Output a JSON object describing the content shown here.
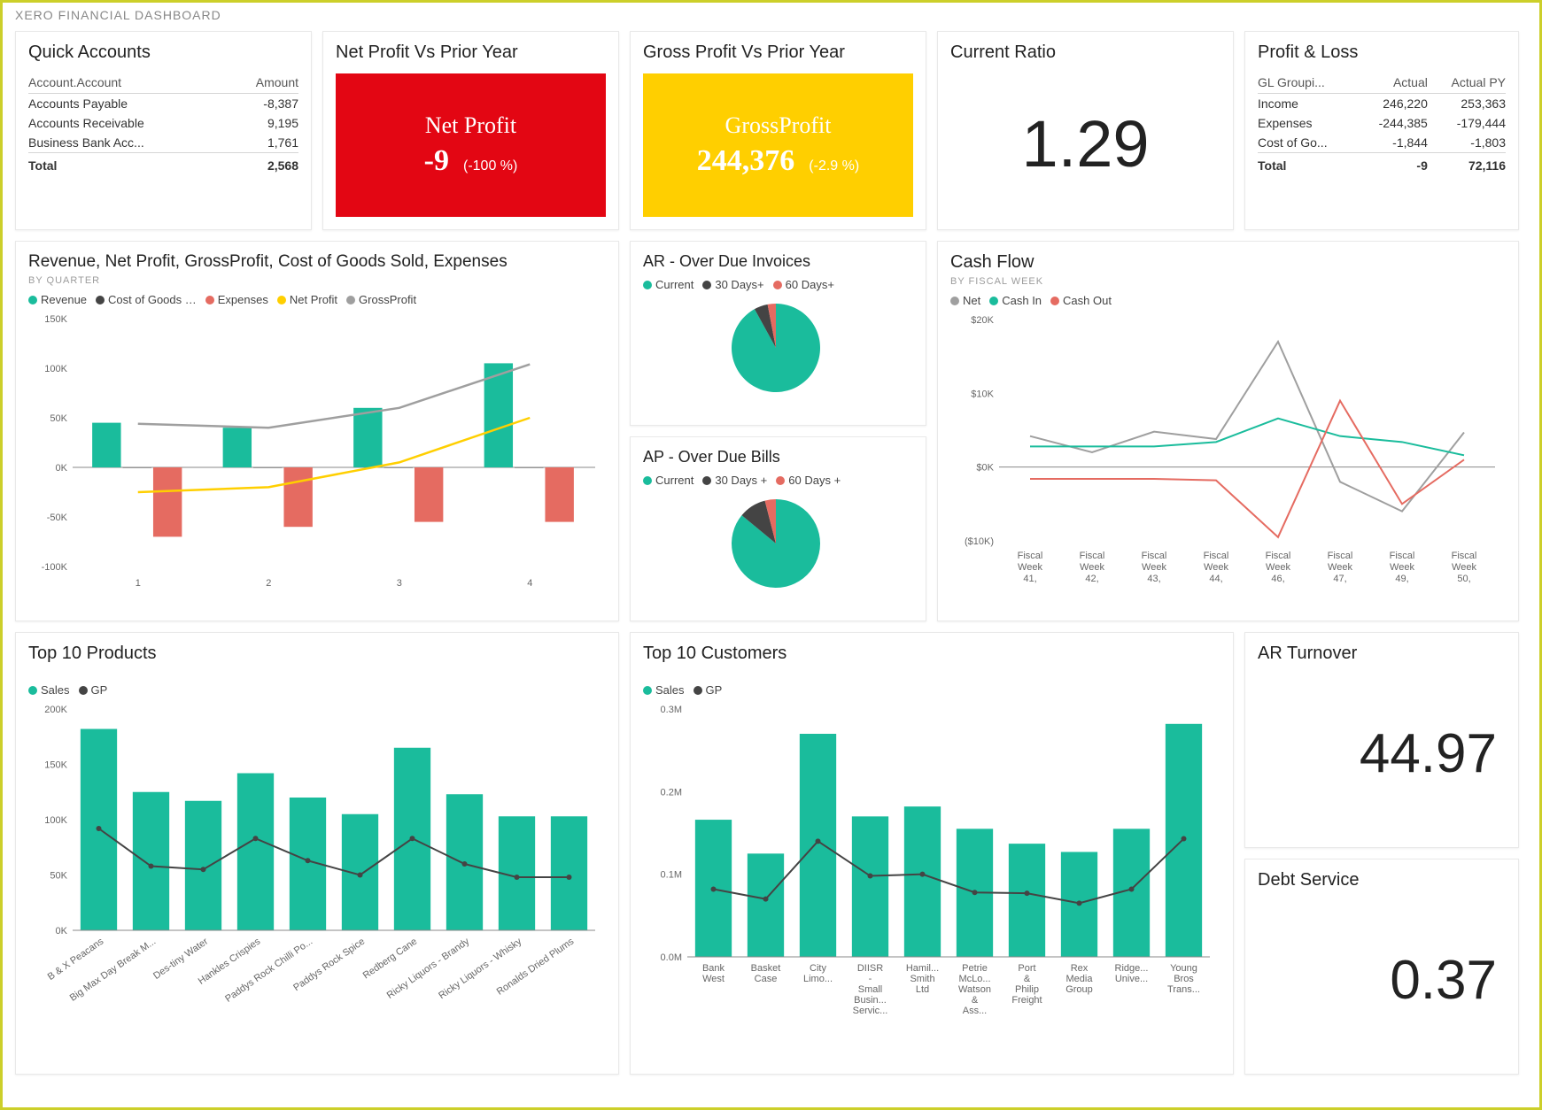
{
  "title": "XERO FINANCIAL DASHBOARD",
  "colors": {
    "teal": "#1abc9c",
    "dark": "#444444",
    "coral": "#e56b61",
    "yellow": "#ffcf00",
    "grey": "#9f9f9f"
  },
  "quick_accounts": {
    "title": "Quick Accounts",
    "columns": [
      "Account.Account",
      "Amount"
    ],
    "rows": [
      {
        "name": "Accounts Payable",
        "amount": "-8,387"
      },
      {
        "name": "Accounts Receivable",
        "amount": "9,195"
      },
      {
        "name": "Business Bank Acc...",
        "amount": "1,761"
      }
    ],
    "total_label": "Total",
    "total": "2,568"
  },
  "net_profit": {
    "title": "Net Profit Vs Prior Year",
    "kpi_label": "Net Profit",
    "value": "-9",
    "delta": "(-100 %)"
  },
  "gross_profit": {
    "title": "Gross Profit Vs Prior Year",
    "kpi_label": "GrossProfit",
    "value": "244,376",
    "delta": "(-2.9 %)"
  },
  "current_ratio": {
    "title": "Current Ratio",
    "value": "1.29"
  },
  "pl": {
    "title": "Profit & Loss",
    "columns": [
      "GL Groupi...",
      "Actual",
      "Actual PY"
    ],
    "rows": [
      {
        "name": "Income",
        "actual": "246,220",
        "py": "253,363"
      },
      {
        "name": "Expenses",
        "actual": "-244,385",
        "py": "-179,444"
      },
      {
        "name": "Cost of Go...",
        "actual": "-1,844",
        "py": "-1,803"
      }
    ],
    "total_label": "Total",
    "actual_total": "-9",
    "py_total": "72,116"
  },
  "rev_chart": {
    "title": "Revenue, Net Profit, GrossProfit, Cost of Goods Sold, Expenses",
    "sub": "BY QUARTER",
    "legend": [
      "Revenue",
      "Cost of Goods …",
      "Expenses",
      "Net Profit",
      "GrossProfit"
    ]
  },
  "ar_due": {
    "title": "AR - Over Due Invoices",
    "legend": [
      "Current",
      "30 Days+",
      "60 Days+"
    ]
  },
  "ap_due": {
    "title": "AP - Over Due Bills",
    "legend": [
      "Current",
      "30 Days +",
      "60 Days +"
    ]
  },
  "cash_flow": {
    "title": "Cash Flow",
    "sub": "BY FISCAL WEEK",
    "legend": [
      "Net",
      "Cash In",
      "Cash Out"
    ]
  },
  "top_products": {
    "title": "Top 10 Products",
    "legend": [
      "Sales",
      "GP"
    ]
  },
  "top_customers": {
    "title": "Top 10 Customers",
    "legend": [
      "Sales",
      "GP"
    ]
  },
  "ar_turnover": {
    "title": "AR Turnover",
    "value": "44.97"
  },
  "debt_service": {
    "title": "Debt Service",
    "value": "0.37"
  },
  "chart_data": [
    {
      "id": "revenue_by_quarter",
      "type": "bar+line",
      "title": "Revenue, Net Profit, GrossProfit, Cost of Goods Sold, Expenses",
      "categories": [
        "1",
        "2",
        "3",
        "4"
      ],
      "ylim": [
        -100000,
        150000
      ],
      "yticks": [
        "150K",
        "100K",
        "50K",
        "0K",
        "-50K",
        "-100K"
      ],
      "series": [
        {
          "name": "Revenue",
          "kind": "bar",
          "color": "#1abc9c",
          "values": [
            45000,
            40000,
            60000,
            105000
          ]
        },
        {
          "name": "Cost of Goods Sold",
          "kind": "bar",
          "color": "#444444",
          "values": [
            -500,
            -500,
            -500,
            -500
          ]
        },
        {
          "name": "Expenses",
          "kind": "bar",
          "color": "#e56b61",
          "values": [
            -70000,
            -60000,
            -55000,
            -55000
          ]
        },
        {
          "name": "Net Profit",
          "kind": "line",
          "color": "#ffcf00",
          "values": [
            -25000,
            -20000,
            5000,
            50000
          ]
        },
        {
          "name": "GrossProfit",
          "kind": "line",
          "color": "#9f9f9f",
          "values": [
            44000,
            40000,
            60000,
            104000
          ]
        }
      ]
    },
    {
      "id": "ar_over_due",
      "type": "pie",
      "title": "AR - Over Due Invoices",
      "slices": [
        {
          "name": "Current",
          "value": 92,
          "color": "#1abc9c"
        },
        {
          "name": "30 Days+",
          "value": 5,
          "color": "#444444"
        },
        {
          "name": "60 Days+",
          "value": 3,
          "color": "#e56b61"
        }
      ]
    },
    {
      "id": "ap_over_due",
      "type": "pie",
      "title": "AP - Over Due Bills",
      "slices": [
        {
          "name": "Current",
          "value": 86,
          "color": "#1abc9c"
        },
        {
          "name": "30 Days +",
          "value": 10,
          "color": "#444444"
        },
        {
          "name": "60 Days +",
          "value": 4,
          "color": "#e56b61"
        }
      ]
    },
    {
      "id": "cash_flow",
      "type": "line",
      "title": "Cash Flow",
      "x": [
        "Fiscal Week 41,",
        "Fiscal Week 42,",
        "Fiscal Week 43,",
        "Fiscal Week 44,",
        "Fiscal Week 46,",
        "Fiscal Week 47,",
        "Fiscal Week 49,",
        "Fiscal Week 50,"
      ],
      "ylim": [
        -10000,
        20000
      ],
      "yticks": [
        "$20K",
        "$10K",
        "$0K",
        "($10K)"
      ],
      "series": [
        {
          "name": "Net",
          "color": "#9f9f9f",
          "values": [
            4200,
            2000,
            4800,
            3800,
            17000,
            -2000,
            -6000,
            4700
          ]
        },
        {
          "name": "Cash In",
          "color": "#1abc9c",
          "values": [
            2800,
            2800,
            2800,
            3400,
            6600,
            4200,
            3400,
            1600
          ]
        },
        {
          "name": "Cash Out",
          "color": "#e56b61",
          "values": [
            -1600,
            -1600,
            -1600,
            -1800,
            -9500,
            9000,
            -5000,
            1000
          ]
        }
      ]
    },
    {
      "id": "top_products",
      "type": "bar+line",
      "title": "Top 10 Products",
      "categories": [
        "B & X Peacans",
        "Big Max Day Break M...",
        "Des-tiny Water",
        "Hankles Crispies",
        "Paddys Rock Chilli Po...",
        "Paddys Rock Spice",
        "Redberg Cane",
        "Ricky Liquors - Brandy",
        "Ricky Liquors - Whisky",
        "Ronalds Dried Plums"
      ],
      "ylim": [
        0,
        200000
      ],
      "yticks": [
        "200K",
        "150K",
        "100K",
        "50K",
        "0K"
      ],
      "series": [
        {
          "name": "Sales",
          "kind": "bar",
          "color": "#1abc9c",
          "values": [
            182000,
            125000,
            117000,
            142000,
            120000,
            105000,
            165000,
            123000,
            103000,
            103000
          ]
        },
        {
          "name": "GP",
          "kind": "line",
          "color": "#444444",
          "values": [
            92000,
            58000,
            55000,
            83000,
            63000,
            50000,
            83000,
            60000,
            48000,
            48000
          ]
        }
      ]
    },
    {
      "id": "top_customers",
      "type": "bar+line",
      "title": "Top 10 Customers",
      "categories": [
        "Bank West",
        "Basket Case",
        "City Limo...",
        "DIISR - Small Busin... Servic...",
        "Hamil... Smith Ltd",
        "Petrie McLo... Watson & Ass...",
        "Port & Philip Freight",
        "Rex Media Group",
        "Ridge... Unive...",
        "Young Bros Trans..."
      ],
      "ylim": [
        0,
        300000
      ],
      "yticks": [
        "0.3M",
        "0.2M",
        "0.1M",
        "0.0M"
      ],
      "series": [
        {
          "name": "Sales",
          "kind": "bar",
          "color": "#1abc9c",
          "values": [
            166000,
            125000,
            270000,
            170000,
            182000,
            155000,
            137000,
            127000,
            155000,
            282000
          ]
        },
        {
          "name": "GP",
          "kind": "line",
          "color": "#444444",
          "values": [
            82000,
            70000,
            140000,
            98000,
            100000,
            78000,
            77000,
            65000,
            82000,
            143000
          ]
        }
      ]
    }
  ]
}
